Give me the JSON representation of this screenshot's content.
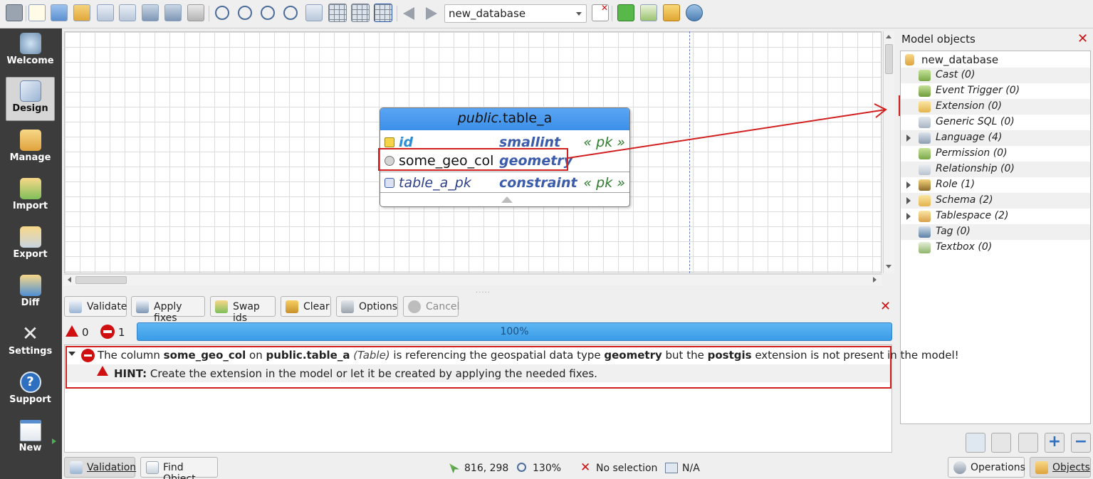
{
  "toolbar": {
    "database_selector": "new_database",
    "icons": [
      "new-model-icon",
      "new-file-icon",
      "open-icon",
      "open-recent-icon",
      "edit-icon",
      "save-as-icon",
      "save-icon",
      "save-all-icon",
      "print-icon",
      "zoom-in-icon",
      "zoom-out-icon",
      "zoom-fit-icon",
      "zoom-reset-icon",
      "arrange-icon",
      "grid-icon",
      "align-grid-icon",
      "overview-icon",
      "back-icon",
      "forward-icon",
      "close-model-icon",
      "plugins-icon",
      "bug-icon",
      "db-objects-icon",
      "fix-model-icon"
    ]
  },
  "left_nav": [
    {
      "label": "Welcome",
      "icon": "welcome-icon"
    },
    {
      "label": "Design",
      "icon": "design-icon"
    },
    {
      "label": "Manage",
      "icon": "manage-icon"
    },
    {
      "label": "Import",
      "icon": "import-icon"
    },
    {
      "label": "Export",
      "icon": "export-icon"
    },
    {
      "label": "Diff",
      "icon": "diff-icon"
    },
    {
      "label": "Settings",
      "icon": "settings-icon"
    },
    {
      "label": "Support",
      "icon": "support-icon"
    },
    {
      "label": "New",
      "icon": "new-icon"
    }
  ],
  "canvas": {
    "table": {
      "schema": "public.",
      "name": "table_a",
      "rows": [
        {
          "name": "id",
          "type": "smallint",
          "tag": "« pk »"
        },
        {
          "name": "some_geo_col",
          "type": "geometry",
          "tag": ""
        },
        {
          "name": "table_a_pk",
          "type": "constraint",
          "tag": "« pk »"
        }
      ]
    }
  },
  "model_objects": {
    "title": "Model objects",
    "root": "new_database",
    "items": [
      {
        "label": "Cast (0)",
        "expandable": false
      },
      {
        "label": "Event Trigger (0)",
        "expandable": false
      },
      {
        "label": "Extension (0)",
        "expandable": false
      },
      {
        "label": "Generic SQL (0)",
        "expandable": false
      },
      {
        "label": "Language (4)",
        "expandable": true
      },
      {
        "label": "Permission (0)",
        "expandable": false
      },
      {
        "label": "Relationship (0)",
        "expandable": false
      },
      {
        "label": "Role (1)",
        "expandable": true
      },
      {
        "label": "Schema (2)",
        "expandable": true
      },
      {
        "label": "Tablespace (2)",
        "expandable": true
      },
      {
        "label": "Tag (0)",
        "expandable": false
      },
      {
        "label": "Textbox (0)",
        "expandable": false
      }
    ]
  },
  "validation": {
    "buttons": [
      "Validate",
      "Apply fixes",
      "Swap ids",
      "Clear",
      "Options",
      "Cancel"
    ],
    "warnings_count": "0",
    "errors_count": "1",
    "progress_text": "100%",
    "progress_value": 1.0,
    "message": {
      "p1": "The column ",
      "col": "some_geo_col",
      "p2": " on ",
      "table": "public.table_a",
      "kind": " (Table)",
      "p3": " is referencing the geospatial data type ",
      "type": "geometry",
      "p4": " but the ",
      "ext": "postgis",
      "p5": " extension is not present in the model!"
    },
    "hint_label": "HINT:",
    "hint_text": " Create the extension in the model or let it be created by applying the needed fixes."
  },
  "status_bar": {
    "validation_btn": "Validation",
    "find_btn": "Find Object",
    "coords": "816, 298",
    "zoom": "130%",
    "selection": "No selection",
    "na": "N/A",
    "operations_btn": "Operations",
    "objects_btn": "Objects"
  },
  "colors": {
    "accent": "#3c8fe8",
    "annotation": "#d21f1f",
    "error": "#d01010"
  }
}
